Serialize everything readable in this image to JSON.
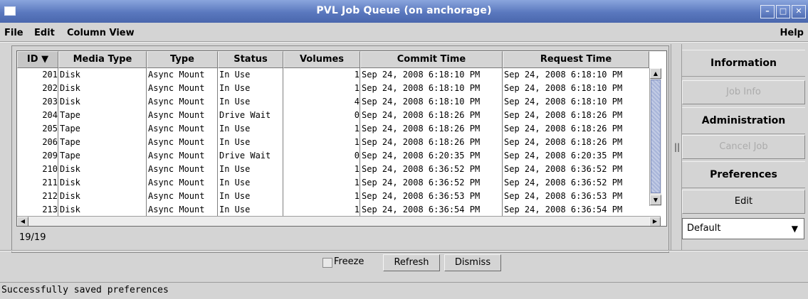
{
  "window": {
    "title": "PVL Job Queue (on anchorage)"
  },
  "menu": {
    "file": "File",
    "edit": "Edit",
    "column_view": "Column View",
    "help": "Help"
  },
  "table": {
    "columns": [
      "ID ▼",
      "Media Type",
      "Type",
      "Status",
      "Volumes",
      "Commit Time",
      "Request Time"
    ],
    "rows": [
      {
        "id": "201",
        "media": "Disk",
        "type": "Async Mount",
        "status": "In Use",
        "volumes": "1",
        "commit": "Sep 24, 2008 6:18:10 PM",
        "request": "Sep 24, 2008 6:18:10 PM"
      },
      {
        "id": "202",
        "media": "Disk",
        "type": "Async Mount",
        "status": "In Use",
        "volumes": "1",
        "commit": "Sep 24, 2008 6:18:10 PM",
        "request": "Sep 24, 2008 6:18:10 PM"
      },
      {
        "id": "203",
        "media": "Disk",
        "type": "Async Mount",
        "status": "In Use",
        "volumes": "4",
        "commit": "Sep 24, 2008 6:18:10 PM",
        "request": "Sep 24, 2008 6:18:10 PM"
      },
      {
        "id": "204",
        "media": "Tape",
        "type": "Async Mount",
        "status": "Drive Wait",
        "volumes": "0",
        "commit": "Sep 24, 2008 6:18:26 PM",
        "request": "Sep 24, 2008 6:18:26 PM"
      },
      {
        "id": "205",
        "media": "Tape",
        "type": "Async Mount",
        "status": "In Use",
        "volumes": "1",
        "commit": "Sep 24, 2008 6:18:26 PM",
        "request": "Sep 24, 2008 6:18:26 PM"
      },
      {
        "id": "206",
        "media": "Tape",
        "type": "Async Mount",
        "status": "In Use",
        "volumes": "1",
        "commit": "Sep 24, 2008 6:18:26 PM",
        "request": "Sep 24, 2008 6:18:26 PM"
      },
      {
        "id": "209",
        "media": "Tape",
        "type": "Async Mount",
        "status": "Drive Wait",
        "volumes": "0",
        "commit": "Sep 24, 2008 6:20:35 PM",
        "request": "Sep 24, 2008 6:20:35 PM"
      },
      {
        "id": "210",
        "media": "Disk",
        "type": "Async Mount",
        "status": "In Use",
        "volumes": "1",
        "commit": "Sep 24, 2008 6:36:52 PM",
        "request": "Sep 24, 2008 6:36:52 PM"
      },
      {
        "id": "211",
        "media": "Disk",
        "type": "Async Mount",
        "status": "In Use",
        "volumes": "1",
        "commit": "Sep 24, 2008 6:36:52 PM",
        "request": "Sep 24, 2008 6:36:52 PM"
      },
      {
        "id": "212",
        "media": "Disk",
        "type": "Async Mount",
        "status": "In Use",
        "volumes": "1",
        "commit": "Sep 24, 2008 6:36:53 PM",
        "request": "Sep 24, 2008 6:36:53 PM"
      },
      {
        "id": "213",
        "media": "Disk",
        "type": "Async Mount",
        "status": "In Use",
        "volumes": "1",
        "commit": "Sep 24, 2008 6:36:54 PM",
        "request": "Sep 24, 2008 6:36:54 PM"
      }
    ],
    "count": "19/19"
  },
  "side": {
    "information": "Information",
    "job_info": "Job Info",
    "administration": "Administration",
    "cancel_job": "Cancel Job",
    "preferences": "Preferences",
    "edit": "Edit",
    "preference_select": "Default"
  },
  "bottom": {
    "freeze": "Freeze",
    "refresh": "Refresh",
    "dismiss": "Dismiss"
  },
  "status_text": "Successfully saved preferences",
  "colors": {
    "titlebar": "#5a78be",
    "panel": "#d4d4d4",
    "thumb": "#a8b5d9"
  }
}
